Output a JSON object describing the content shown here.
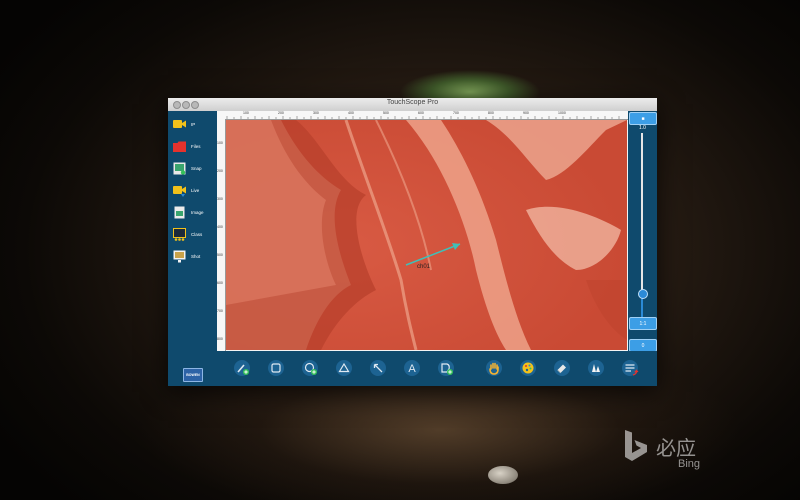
{
  "window": {
    "title": "TouchScope Pro"
  },
  "sidebar": {
    "items": [
      {
        "label": "IP",
        "icon": "video-camera-icon",
        "color": "#f2c21b"
      },
      {
        "label": "Files",
        "icon": "folder-icon",
        "color": "#e5322d"
      },
      {
        "label": "Snap",
        "icon": "snapshot-icon",
        "color": "#3aa56e"
      },
      {
        "label": "Live",
        "icon": "live-camera-icon",
        "color": "#f2c21b"
      },
      {
        "label": "Image",
        "icon": "image-file-icon",
        "color": "#3aa56e"
      },
      {
        "label": "Class",
        "icon": "class-board-icon",
        "color": "#f2c21b"
      },
      {
        "label": "Shot",
        "icon": "screen-shot-icon",
        "color": "#f3f3f3"
      }
    ],
    "logo_text": "BOWEN"
  },
  "ruler": {
    "top_ticks": [
      "100",
      "200",
      "300",
      "400",
      "500",
      "600",
      "700",
      "800",
      "900",
      "1000"
    ],
    "left_ticks": [
      "100",
      "200",
      "300",
      "400",
      "500",
      "600",
      "700",
      "800"
    ]
  },
  "annotation": {
    "label": "ch01",
    "color": "#3fc0b8"
  },
  "right_panel": {
    "zoom_max": "1.0",
    "ratio_button": "1:1",
    "reset_button": "0",
    "zoom_level": 0.18
  },
  "toolbar": {
    "tools": [
      "pen-add-icon",
      "rectangle-icon",
      "circle-add-icon",
      "triangle-icon",
      "arrow-icon",
      "text-icon",
      "polygon-add-icon",
      "hand-icon",
      "palette-icon",
      "eraser-icon",
      "color-fill-icon",
      "menu-undo-icon"
    ],
    "text_tool_glyph": "A"
  },
  "colors": {
    "accent": "#3c9ee6",
    "panel": "#0f4a6d",
    "badge_green": "#35c15a"
  },
  "bing": {
    "cn": "必应",
    "en": "Bing"
  }
}
